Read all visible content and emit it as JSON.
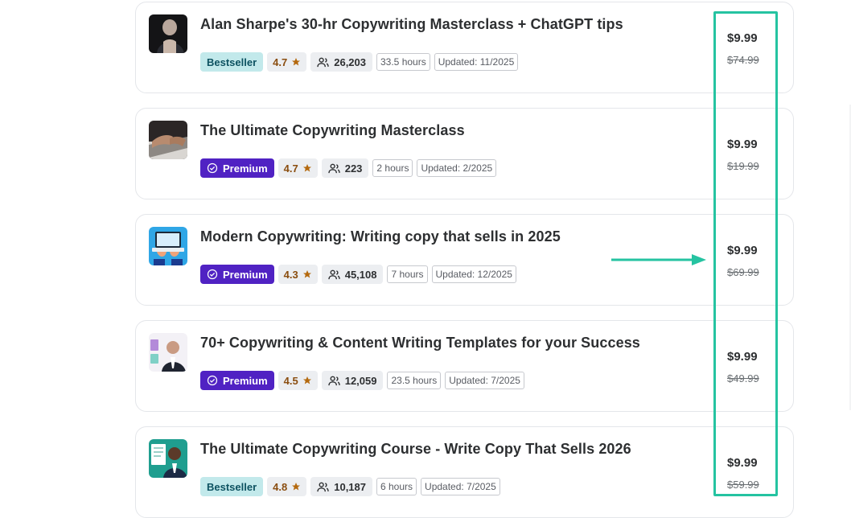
{
  "colors": {
    "bestseller_bg": "#c2e9eb",
    "premium_bg": "#5022c3",
    "rating_text": "#8a4d0f",
    "highlight": "#25c3a1"
  },
  "icons": {
    "premium": "badge-check-icon",
    "rating": "star-icon",
    "students": "people-icon",
    "annotation": "arrow-right-icon"
  },
  "courses": [
    {
      "title": "Alan Sharpe's 30-hr Copywriting Masterclass + ChatGPT tips",
      "badge": "Bestseller",
      "rating": "4.7",
      "students": "26,203",
      "duration": "33.5 hours",
      "updated": "Updated: 11/2025",
      "price": "$9.99",
      "original_price": "$74.99"
    },
    {
      "title": "The Ultimate Copywriting Masterclass",
      "badge": "Premium",
      "rating": "4.7",
      "students": "223",
      "duration": "2 hours",
      "updated": "Updated: 2/2025",
      "price": "$9.99",
      "original_price": "$19.99"
    },
    {
      "title": "Modern Copywriting: Writing copy that sells in 2025",
      "badge": "Premium",
      "rating": "4.3",
      "students": "45,108",
      "duration": "7 hours",
      "updated": "Updated: 12/2025",
      "price": "$9.99",
      "original_price": "$69.99"
    },
    {
      "title": "70+ Copywriting & Content Writing Templates for your Success",
      "badge": "Premium",
      "rating": "4.5",
      "students": "12,059",
      "duration": "23.5 hours",
      "updated": "Updated: 7/2025",
      "price": "$9.99",
      "original_price": "$49.99"
    },
    {
      "title": "The Ultimate Copywriting Course - Write Copy That Sells 2026",
      "badge": "Bestseller",
      "rating": "4.8",
      "students": "10,187",
      "duration": "6 hours",
      "updated": "Updated: 7/2025",
      "price": "$9.99",
      "original_price": "$59.99"
    }
  ]
}
